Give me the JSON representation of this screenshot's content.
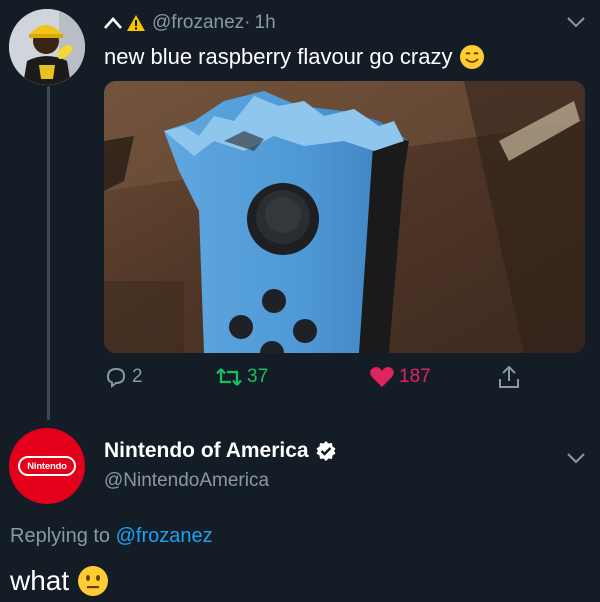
{
  "tweet": {
    "handle": "@frozanez",
    "separator": "·",
    "time": "1h",
    "text": "new blue raspberry flavour go crazy",
    "emoji": "smiling-face-emoji",
    "actions": {
      "replies": "2",
      "retweets": "37",
      "likes": "187"
    },
    "colors": {
      "retweet": "#17bf63",
      "like": "#e0245e",
      "muted": "#8899a6"
    }
  },
  "reply": {
    "display_name": "Nintendo of America",
    "verified": true,
    "handle": "@NintendoAmerica",
    "avatar_logo_text": "Nintendo",
    "replying_prefix": "Replying to",
    "replying_to": "@frozanez",
    "text": "what",
    "emoji": "neutral-face-emoji"
  },
  "theme": {
    "background": "#141d26",
    "link": "#1da1f2",
    "brand_red": "#e4001b"
  }
}
